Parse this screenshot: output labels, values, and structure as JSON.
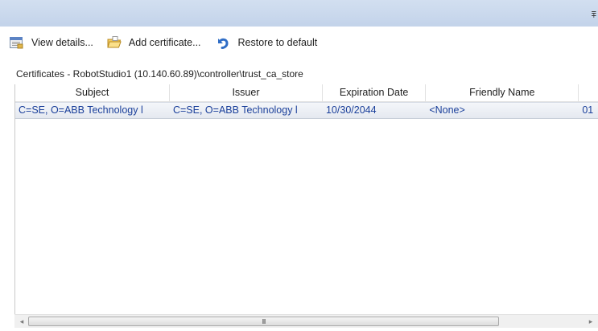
{
  "titlebar": {
    "glyph": "⩱"
  },
  "toolbar": {
    "view_details_label": "View details...",
    "add_certificate_label": "Add certificate...",
    "restore_default_label": "Restore to default"
  },
  "path_label": "Certificates - RobotStudio1 (10.140.60.89)\\controller\\trust_ca_store",
  "grid": {
    "columns": [
      "Subject",
      "Issuer",
      "Expiration Date",
      "Friendly Name",
      ""
    ],
    "rows": [
      {
        "subject": "C=SE, O=ABB Technology l",
        "issuer": "C=SE, O=ABB Technology l",
        "expiration": "10/30/2044",
        "friendly": "<None>",
        "extra": "01"
      }
    ]
  },
  "scrollbar": {
    "left_arrow": "◂",
    "right_arrow": "▸",
    "grip": "III"
  },
  "colors": {
    "title_strip": "#c3d3ea",
    "row_text": "#1a3f9a",
    "selected_row": "#e5e9f0"
  },
  "icons": {
    "view_details": "view-details-icon",
    "add_certificate": "open-folder-icon",
    "restore_default": "undo-arrow-icon"
  }
}
